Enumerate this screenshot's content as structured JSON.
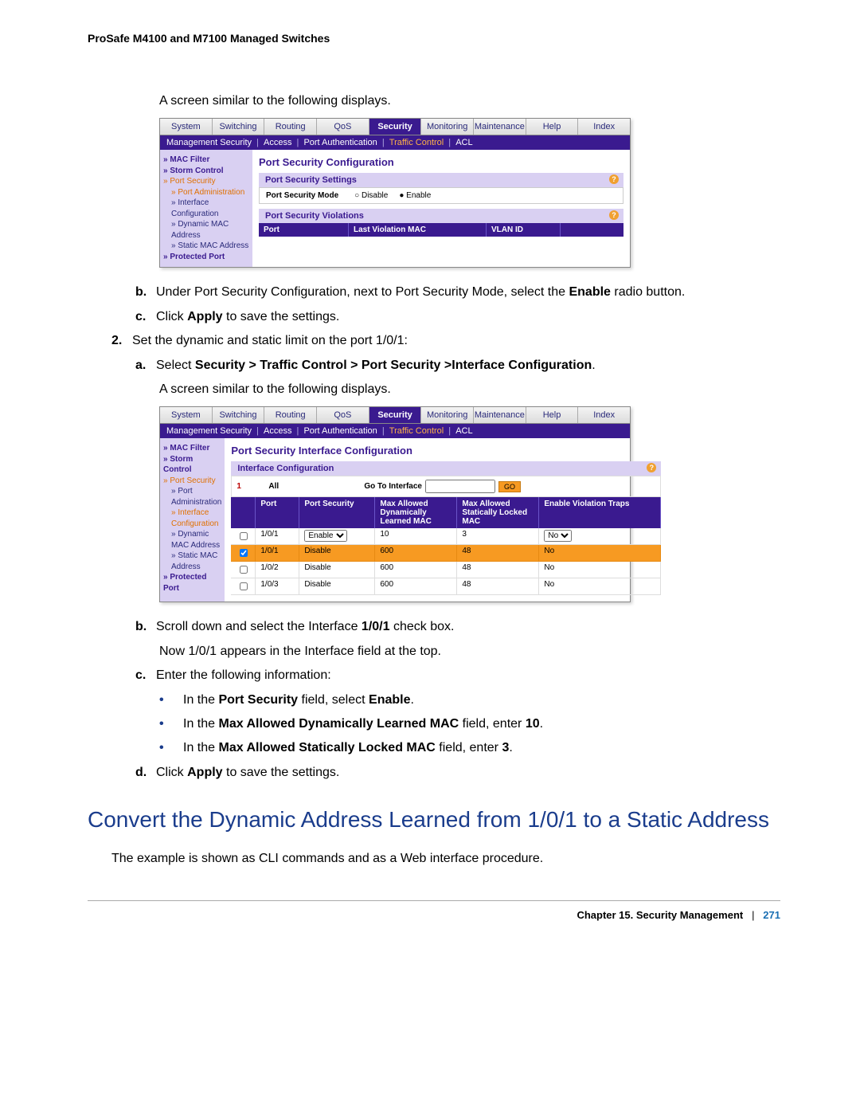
{
  "doc_title": "ProSafe M4100 and M7100 Managed Switches",
  "intro1": "A screen similar to the following displays.",
  "step_b": "Under Port Security Configuration, next to Port Security Mode, select the ",
  "step_b_bold": "Enable",
  "step_b_tail": " radio button.",
  "step_c_pre": "Click ",
  "step_c_bold": "Apply",
  "step_c_tail": " to save the settings.",
  "step2": "Set the dynamic and static limit on the port 1/0/1:",
  "step2a_pre": "Select ",
  "step2a_bold": "Security > Traffic Control > Port Security >Interface Configuration",
  "step2a_tail": ".",
  "intro2": "A screen similar to the following displays.",
  "step2b_pre": "Scroll down and select the Interface ",
  "step2b_bold": "1/0/1",
  "step2b_tail": " check box.",
  "step2b_extra": "Now 1/0/1 appears in the Interface field at the top.",
  "step2c": "Enter the following information:",
  "bul1_pre": "In the ",
  "bul1_bold": "Port Security",
  "bul1_mid": " field, select ",
  "bul1_bold2": "Enable",
  "bul1_tail": ".",
  "bul2_pre": "In the ",
  "bul2_bold": "Max Allowed Dynamically Learned MAC",
  "bul2_mid": " field, enter ",
  "bul2_bold2": "10",
  "bul2_tail": ".",
  "bul3_pre": "In the ",
  "bul3_bold": "Max Allowed Statically Locked MAC",
  "bul3_mid": " field, enter ",
  "bul3_bold2": "3",
  "bul3_tail": ".",
  "step2d_pre": "Click ",
  "step2d_bold": "Apply",
  "step2d_tail": " to save the settings.",
  "heading": "Convert the Dynamic Address Learned from 1/0/1 to a Static Address",
  "heading_body": "The example is shown as CLI commands and as a Web interface procedure.",
  "footer_chapter": "Chapter 15.  Security Management",
  "footer_page": "271",
  "tabs": [
    "System",
    "Switching",
    "Routing",
    "QoS",
    "Security",
    "Monitoring",
    "Maintenance",
    "Help",
    "Index"
  ],
  "subbar": {
    "items": [
      "Management Security",
      "Access",
      "Port Authentication",
      "Traffic Control",
      "ACL"
    ],
    "highlight": "Traffic Control"
  },
  "sidebar1": [
    {
      "txt": "MAC Filter",
      "cls": "sg"
    },
    {
      "txt": "Storm Control",
      "cls": "sg"
    },
    {
      "txt": "Port Security",
      "cls": "orange"
    },
    {
      "txt": "Port Administration",
      "cls": "sub sel"
    },
    {
      "txt": "Interface Configuration",
      "cls": "sub"
    },
    {
      "txt": "Dynamic MAC Address",
      "cls": "sub"
    },
    {
      "txt": "Static MAC Address",
      "cls": "sub"
    },
    {
      "txt": "Protected Port",
      "cls": "sg"
    }
  ],
  "sidebar2": [
    {
      "txt": "MAC Filter",
      "cls": "sg"
    },
    {
      "txt": "Storm Control",
      "cls": "sg"
    },
    {
      "txt": "Port Security",
      "cls": "orange"
    },
    {
      "txt": "Port Administration",
      "cls": "sub"
    },
    {
      "txt": "Interface Configuration",
      "cls": "sub sel"
    },
    {
      "txt": "Dynamic MAC Address",
      "cls": "sub"
    },
    {
      "txt": "Static MAC Address",
      "cls": "sub"
    },
    {
      "txt": "Protected Port",
      "cls": "sg"
    }
  ],
  "shot1": {
    "title": "Port Security Configuration",
    "sec1": "Port Security Settings",
    "mode_label": "Port Security Mode",
    "opt_disable": "Disable",
    "opt_enable": "Enable",
    "sec2": "Port Security Violations",
    "hdr": [
      "Port",
      "Last Violation MAC",
      "VLAN ID"
    ]
  },
  "shot2": {
    "title": "Port Security Interface Configuration",
    "sec1": "Interface Configuration",
    "goto_one": "1",
    "goto_all": "All",
    "goto_lbl": "Go To Interface",
    "go": "GO",
    "hdr": [
      "",
      "Port",
      "Port Security",
      "Max Allowed Dynamically Learned MAC",
      "Max Allowed Statically Locked MAC",
      "Enable Violation Traps"
    ],
    "rows": [
      {
        "cb": false,
        "port": "1/0/1",
        "ps": "Enable",
        "m1": "10",
        "m2": "3",
        "tr": "No",
        "editable": true
      },
      {
        "cb": true,
        "port": "1/0/1",
        "ps": "Disable",
        "m1": "600",
        "m2": "48",
        "tr": "No",
        "orange": true
      },
      {
        "cb": false,
        "port": "1/0/2",
        "ps": "Disable",
        "m1": "600",
        "m2": "48",
        "tr": "No"
      },
      {
        "cb": false,
        "port": "1/0/3",
        "ps": "Disable",
        "m1": "600",
        "m2": "48",
        "tr": "No"
      }
    ]
  }
}
